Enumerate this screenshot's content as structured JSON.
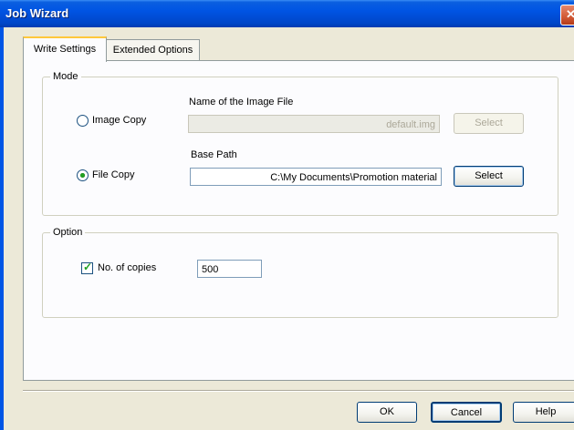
{
  "window": {
    "title": "Job Wizard"
  },
  "tabs": [
    {
      "label": "Write Settings",
      "active": true
    },
    {
      "label": "Extended Options",
      "active": false
    }
  ],
  "mode": {
    "legend": "Mode",
    "image_copy": {
      "label": "Image Copy",
      "checked": false,
      "field_label": "Name of the Image File",
      "field_value": "default.img",
      "select_label": "Select",
      "enabled": false
    },
    "file_copy": {
      "label": "File Copy",
      "checked": true,
      "field_label": "Base Path",
      "field_value": "C:\\My Documents\\Promotion material",
      "select_label": "Select",
      "enabled": true
    }
  },
  "option": {
    "legend": "Option",
    "copies": {
      "label": "No. of copies",
      "checked": true,
      "value": "500"
    }
  },
  "footer": {
    "ok_label": "OK",
    "cancel_label": "Cancel",
    "help_label": "Help"
  },
  "colors": {
    "titlebar": "#0054e3",
    "dialog_bg": "#ece9d8",
    "tab_highlight": "#ffc83c"
  }
}
